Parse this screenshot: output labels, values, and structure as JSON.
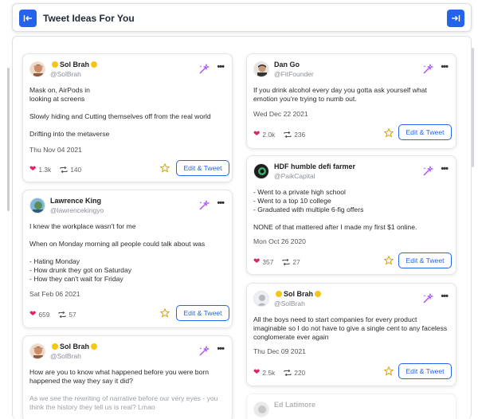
{
  "header": {
    "title": "Tweet Ideas For You"
  },
  "colors": {
    "accent": "#2563eb",
    "heart": "#e0245e",
    "star": "#d4a20d",
    "magic": "#a855f7"
  },
  "left_column": [
    {
      "name": "Sol Brah",
      "handle": "@SolBrah",
      "body": "Mask on, AirPods in\nlooking at screens\n\nSlowly hiding and Cutting themselves off from the real world\n\nDrifting into the metaverse",
      "date": "Thu Nov 04 2021",
      "likes": "1.3k",
      "retweets": "140",
      "button": "Edit & Tweet"
    },
    {
      "name": "Lawrence King",
      "handle": "@lawrencekingyo",
      "body": "I knew the workplace wasn't for me\n\nWhen on Monday morning all people could talk about was\n\n- Hating Monday\n- How drunk they got on Saturday\n- How they can't wait for Friday",
      "date": "Sat Feb 06 2021",
      "likes": "659",
      "retweets": "57",
      "button": "Edit & Tweet"
    },
    {
      "name": "Sol Brah",
      "handle": "@SolBrah",
      "body": "How are you to know what happened before you were born happened the way they say it did?",
      "body_faded": "As we see the rewriting of narrative before our very eyes - you think the history they tell us is real? Lmao"
    }
  ],
  "right_column": [
    {
      "name": "Dan Go",
      "handle": "@FitFounder",
      "body": "If you drink alcohol every day you gotta ask yourself what emotion you're trying to numb out.",
      "date": "Wed Dec 22 2021",
      "likes": "2.0k",
      "retweets": "236",
      "button": "Edit & Tweet"
    },
    {
      "name": "HDF humble defi farmer",
      "handle": "@PaikCapital",
      "body": "- Went to a private high school\n- Went to a top 10 college\n- Graduated with multiple 6-fig offers\n\nNONE of that mattered after I made my first $1 online.",
      "date": "Mon Oct 26 2020",
      "likes": "357",
      "retweets": "27",
      "button": "Edit & Tweet"
    },
    {
      "name": "Sol Brah",
      "handle": "@SolBrah",
      "body": "All the boys need to start companies for every product imaginable so I do not have to give a single cent to any faceless conglomerate ever again",
      "date": "Thu Dec 09 2021",
      "likes": "2.5k",
      "retweets": "220",
      "button": "Edit & Tweet"
    },
    {
      "name": "Ed Latimore"
    }
  ]
}
